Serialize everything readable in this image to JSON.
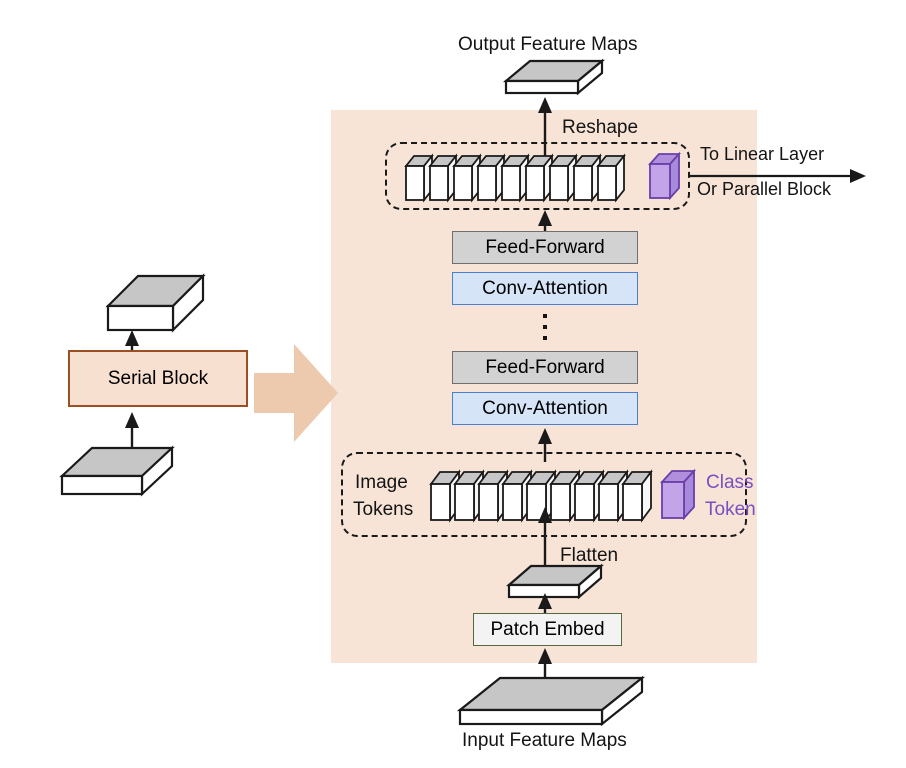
{
  "diagram": {
    "title": "Serial Block architecture diagram",
    "colors": {
      "panel_background": "#f7e4d7",
      "big_arrow": "#edc9ae",
      "feed_forward_fill": "#d2d2d2",
      "feed_forward_border": "#6f6f6f",
      "conv_attention_fill": "#d6e4f8",
      "conv_attention_border": "#4a7fd4",
      "patch_embed_fill": "#f3f3f3",
      "patch_embed_border": "#55683a",
      "serial_block_fill": "#f7e0d0",
      "serial_block_border": "#9c4f22",
      "class_token_fill": "#c3a4e8",
      "class_token_top": "#b18fdc",
      "class_token_text": "#7a4fbf",
      "slab_top": "#c6c6c6",
      "slab_front": "#ffffff",
      "stroke": "#1a1a1a"
    },
    "left": {
      "output_box_name": "output-feature-cube",
      "serial_block_label": "Serial Block",
      "input_box_name": "input-feature-cube",
      "big_arrow_name": "expand-arrow-right"
    },
    "right": {
      "output_label": "Output Feature Maps",
      "reshape_label": "Reshape",
      "to_linear_label_line1": "To Linear Layer",
      "to_linear_label_line2": "Or Parallel Block",
      "blocks": [
        {
          "label": "Feed-Forward",
          "kind": "feed-forward"
        },
        {
          "label": "Conv-Attention",
          "kind": "conv-attention"
        },
        {
          "label": "Feed-Forward",
          "kind": "feed-forward"
        },
        {
          "label": "Conv-Attention",
          "kind": "conv-attention"
        }
      ],
      "ellipsis": "⋮",
      "image_tokens_label_line1": "Image",
      "image_tokens_label_line2": "Tokens",
      "class_token_label_line1": "Class",
      "class_token_label_line2": "Token",
      "flatten_label": "Flatten",
      "patch_embed_label": "Patch Embed",
      "input_label": "Input Feature Maps",
      "token_count_top": 9,
      "token_count_bottom": 9
    }
  }
}
